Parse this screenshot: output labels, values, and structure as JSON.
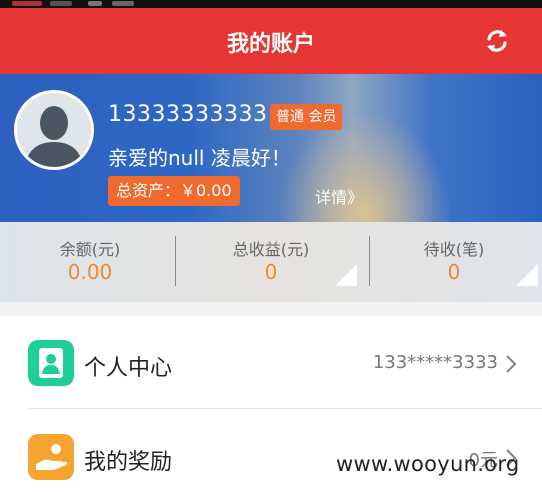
{
  "header": {
    "title": "我的账户",
    "refresh_icon": "refresh-icon",
    "background": "#e53535"
  },
  "profile": {
    "phone": "13333333333",
    "member_level": "普通 会员",
    "greeting": "亲爱的null 凌晨好！",
    "total_assets": "总资产：￥0.00",
    "details_link": "详情》",
    "avatar_icon": "default-avatar-icon",
    "accent": "#ef6a2f"
  },
  "stats": [
    {
      "label": "余额(元)",
      "value": "0.00"
    },
    {
      "label": "总收益(元)",
      "value": "0"
    },
    {
      "label": "待收(笔)",
      "value": "0"
    }
  ],
  "menu": [
    {
      "label": "个人中心",
      "value": "133*****3333",
      "icon": "person-icon",
      "icon_color": "#1fcf9a"
    },
    {
      "label": "我的奖励",
      "value": "0元",
      "icon": "reward-hand-icon",
      "icon_color": "#f5a431"
    }
  ],
  "watermark": "www.wooyun.org",
  "colors": {
    "value_orange": "#f08a2c",
    "banner_blue": "#2e67c4"
  }
}
